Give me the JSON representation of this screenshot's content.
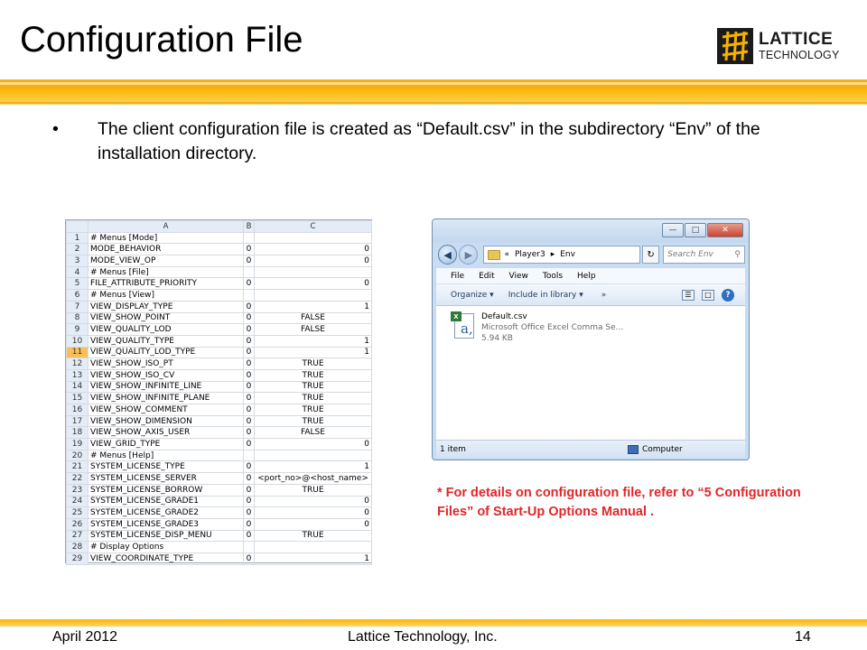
{
  "slide": {
    "title": "Configuration File",
    "bullet": "The client configuration file is created as “Default.csv” in the subdirectory “Env” of the installation directory.",
    "bullet_marker": "•",
    "note": "* For details on configuration file, refer to “5 Configuration Files” of Start-Up Options Manual .",
    "accent_color": "#f5b000",
    "note_color": "#e0272a"
  },
  "logo": {
    "line1": "LATTICE",
    "line2": "TECHNOLOGY",
    "icon": "lattice-logo-icon"
  },
  "footer": {
    "date": "April 2012",
    "company": "Lattice Technology, Inc.",
    "page": "14"
  },
  "spreadsheet": {
    "columns": [
      "A",
      "B",
      "C"
    ],
    "selected_row": "11",
    "rows": [
      {
        "n": "1",
        "a": "# Menus [Mode]",
        "b": "",
        "c": ""
      },
      {
        "n": "2",
        "a": "MODE_BEHAVIOR",
        "b": "0",
        "c": "0"
      },
      {
        "n": "3",
        "a": "MODE_VIEW_OP",
        "b": "0",
        "c": "0"
      },
      {
        "n": "4",
        "a": "# Menus [File]",
        "b": "",
        "c": ""
      },
      {
        "n": "5",
        "a": "FILE_ATTRIBUTE_PRIORITY",
        "b": "0",
        "c": "0"
      },
      {
        "n": "6",
        "a": "# Menus [View]",
        "b": "",
        "c": ""
      },
      {
        "n": "7",
        "a": "VIEW_DISPLAY_TYPE",
        "b": "0",
        "c": "1"
      },
      {
        "n": "8",
        "a": "VIEW_SHOW_POINT",
        "b": "0",
        "c": "FALSE"
      },
      {
        "n": "9",
        "a": "VIEW_QUALITY_LOD",
        "b": "0",
        "c": "FALSE"
      },
      {
        "n": "10",
        "a": "VIEW_QUALITY_TYPE",
        "b": "0",
        "c": "1"
      },
      {
        "n": "11",
        "a": "VIEW_QUALITY_LOD_TYPE",
        "b": "0",
        "c": "1"
      },
      {
        "n": "12",
        "a": "VIEW_SHOW_ISO_PT",
        "b": "0",
        "c": "TRUE"
      },
      {
        "n": "13",
        "a": "VIEW_SHOW_ISO_CV",
        "b": "0",
        "c": "TRUE"
      },
      {
        "n": "14",
        "a": "VIEW_SHOW_INFINITE_LINE",
        "b": "0",
        "c": "TRUE"
      },
      {
        "n": "15",
        "a": "VIEW_SHOW_INFINITE_PLANE",
        "b": "0",
        "c": "TRUE"
      },
      {
        "n": "16",
        "a": "VIEW_SHOW_COMMENT",
        "b": "0",
        "c": "TRUE"
      },
      {
        "n": "17",
        "a": "VIEW_SHOW_DIMENSION",
        "b": "0",
        "c": "TRUE"
      },
      {
        "n": "18",
        "a": "VIEW_SHOW_AXIS_USER",
        "b": "0",
        "c": "FALSE"
      },
      {
        "n": "19",
        "a": "VIEW_GRID_TYPE",
        "b": "0",
        "c": "0"
      },
      {
        "n": "20",
        "a": "# Menus [Help]",
        "b": "",
        "c": ""
      },
      {
        "n": "21",
        "a": "SYSTEM_LICENSE_TYPE",
        "b": "0",
        "c": "1"
      },
      {
        "n": "22",
        "a": "SYSTEM_LICENSE_SERVER",
        "b": "0",
        "c": "<port_no>@<host_name>"
      },
      {
        "n": "23",
        "a": "SYSTEM_LICENSE_BORROW",
        "b": "0",
        "c": "TRUE"
      },
      {
        "n": "24",
        "a": "SYSTEM_LICENSE_GRADE1",
        "b": "0",
        "c": "0"
      },
      {
        "n": "25",
        "a": "SYSTEM_LICENSE_GRADE2",
        "b": "0",
        "c": "0"
      },
      {
        "n": "26",
        "a": "SYSTEM_LICENSE_GRADE3",
        "b": "0",
        "c": "0"
      },
      {
        "n": "27",
        "a": "SYSTEM_LICENSE_DISP_MENU",
        "b": "0",
        "c": "TRUE"
      },
      {
        "n": "28",
        "a": "# Display Options",
        "b": "",
        "c": ""
      },
      {
        "n": "29",
        "a": "VIEW_COORDINATE_TYPE",
        "b": "0",
        "c": "1"
      }
    ]
  },
  "explorer": {
    "window_buttons": {
      "minimize": "—",
      "maximize": "□",
      "close": "✕"
    },
    "back_icon": "back-arrow-icon",
    "breadcrumb_prefix": "«",
    "breadcrumb": [
      "Player3",
      "Env"
    ],
    "breadcrumb_sep": "▸",
    "search_placeholder": "Search Env",
    "menu": [
      "File",
      "Edit",
      "View",
      "Tools",
      "Help"
    ],
    "toolbar": {
      "organize": "Organize ▾",
      "include": "Include in library ▾",
      "more": "»"
    },
    "file": {
      "name": "Default.csv",
      "type": "Microsoft Office Excel Comma Se...",
      "size": "5.94 KB"
    },
    "status_count": "1 item",
    "status_location": "Computer"
  }
}
